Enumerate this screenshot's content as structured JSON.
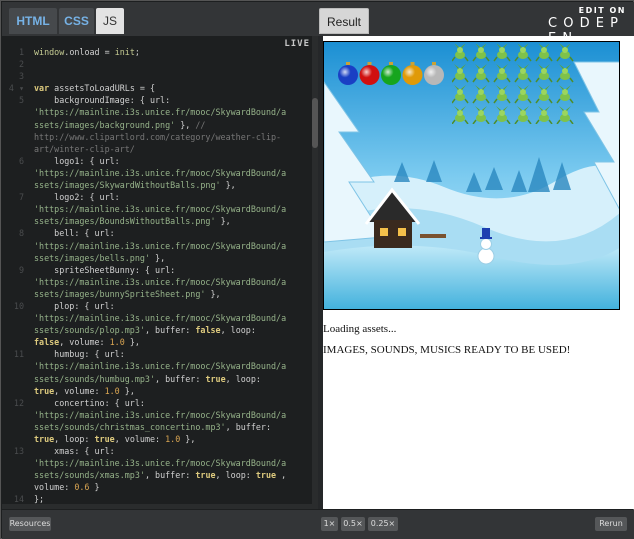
{
  "tabs": {
    "html": "HTML",
    "css": "CSS",
    "js": "JS",
    "result": "Result"
  },
  "brand": {
    "edit_on": "EDIT ON",
    "name": "C O D E P E N"
  },
  "editor": {
    "live_badge": "LIVE",
    "lines": [
      {
        "n": "1",
        "segs": [
          [
            "prop",
            "window"
          ],
          [
            "",
            "."
          ],
          [
            "",
            "onload = "
          ],
          [
            "prop",
            "init"
          ],
          [
            "",
            ";"
          ]
        ]
      },
      {
        "n": "2",
        "segs": []
      },
      {
        "n": "3",
        "segs": []
      },
      {
        "n": "4 ▾",
        "segs": [
          [
            "kw",
            "var"
          ],
          [
            "",
            " assetsToLoadURLs = {"
          ]
        ]
      },
      {
        "n": "5",
        "segs": [
          [
            "",
            "    backgroundImage: { url:"
          ]
        ]
      },
      {
        "n": "",
        "segs": [
          [
            "str",
            "'https://mainline.i3s.unice.fr/mooc/SkywardBound/a"
          ]
        ]
      },
      {
        "n": "",
        "segs": [
          [
            "str",
            "ssets/images/background.png'"
          ],
          [
            "",
            " }, "
          ],
          [
            "cmt",
            "//"
          ]
        ]
      },
      {
        "n": "",
        "segs": [
          [
            "cmt",
            "http://www.clipartlord.com/category/weather-clip-"
          ]
        ]
      },
      {
        "n": "",
        "segs": [
          [
            "cmt",
            "art/winter-clip-art/"
          ]
        ]
      },
      {
        "n": "6",
        "segs": [
          [
            "",
            "    logo1: { url:"
          ]
        ]
      },
      {
        "n": "",
        "segs": [
          [
            "str",
            "'https://mainline.i3s.unice.fr/mooc/SkywardBound/a"
          ]
        ]
      },
      {
        "n": "",
        "segs": [
          [
            "str",
            "ssets/images/SkywardWithoutBalls.png'"
          ],
          [
            "",
            " },"
          ]
        ]
      },
      {
        "n": "7",
        "segs": [
          [
            "",
            "    logo2: { url:"
          ]
        ]
      },
      {
        "n": "",
        "segs": [
          [
            "str",
            "'https://mainline.i3s.unice.fr/mooc/SkywardBound/a"
          ]
        ]
      },
      {
        "n": "",
        "segs": [
          [
            "str",
            "ssets/images/BoundsWithoutBalls.png'"
          ],
          [
            "",
            " },"
          ]
        ]
      },
      {
        "n": "8",
        "segs": [
          [
            "",
            "    bell: { url:"
          ]
        ]
      },
      {
        "n": "",
        "segs": [
          [
            "str",
            "'https://mainline.i3s.unice.fr/mooc/SkywardBound/a"
          ]
        ]
      },
      {
        "n": "",
        "segs": [
          [
            "str",
            "ssets/images/bells.png'"
          ],
          [
            "",
            " },"
          ]
        ]
      },
      {
        "n": "9",
        "segs": [
          [
            "",
            "    spriteSheetBunny: { url:"
          ]
        ]
      },
      {
        "n": "",
        "segs": [
          [
            "str",
            "'https://mainline.i3s.unice.fr/mooc/SkywardBound/a"
          ]
        ]
      },
      {
        "n": "",
        "segs": [
          [
            "str",
            "ssets/images/bunnySpriteSheet.png'"
          ],
          [
            "",
            " },"
          ]
        ]
      },
      {
        "n": "10",
        "segs": [
          [
            "",
            "    plop: { url:"
          ]
        ]
      },
      {
        "n": "",
        "segs": [
          [
            "str",
            "'https://mainline.i3s.unice.fr/mooc/SkywardBound/a"
          ]
        ]
      },
      {
        "n": "",
        "segs": [
          [
            "str",
            "ssets/sounds/plop.mp3'"
          ],
          [
            "",
            ", buffer: "
          ],
          [
            "kw",
            "false"
          ],
          [
            "",
            ", loop:"
          ]
        ]
      },
      {
        "n": "",
        "segs": [
          [
            "kw",
            "false"
          ],
          [
            "",
            ", volume: "
          ],
          [
            "num",
            "1.0"
          ],
          [
            "",
            " },"
          ]
        ]
      },
      {
        "n": "11",
        "segs": [
          [
            "",
            "    humbug: { url:"
          ]
        ]
      },
      {
        "n": "",
        "segs": [
          [
            "str",
            "'https://mainline.i3s.unice.fr/mooc/SkywardBound/a"
          ]
        ]
      },
      {
        "n": "",
        "segs": [
          [
            "str",
            "ssets/sounds/humbug.mp3'"
          ],
          [
            "",
            ", buffer: "
          ],
          [
            "kw",
            "true"
          ],
          [
            "",
            ", loop:"
          ]
        ]
      },
      {
        "n": "",
        "segs": [
          [
            "kw",
            "true"
          ],
          [
            "",
            ", volume: "
          ],
          [
            "num",
            "1.0"
          ],
          [
            "",
            " },"
          ]
        ]
      },
      {
        "n": "12",
        "segs": [
          [
            "",
            "    concertino: { url:"
          ]
        ]
      },
      {
        "n": "",
        "segs": [
          [
            "str",
            "'https://mainline.i3s.unice.fr/mooc/SkywardBound/a"
          ]
        ]
      },
      {
        "n": "",
        "segs": [
          [
            "str",
            "ssets/sounds/christmas_concertino.mp3'"
          ],
          [
            "",
            ", buffer:"
          ]
        ]
      },
      {
        "n": "",
        "segs": [
          [
            "kw",
            "true"
          ],
          [
            "",
            ", loop: "
          ],
          [
            "kw",
            "true"
          ],
          [
            "",
            ", volume: "
          ],
          [
            "num",
            "1.0"
          ],
          [
            "",
            " },"
          ]
        ]
      },
      {
        "n": "13",
        "segs": [
          [
            "",
            "    xmas: { url:"
          ]
        ]
      },
      {
        "n": "",
        "segs": [
          [
            "str",
            "'https://mainline.i3s.unice.fr/mooc/SkywardBound/a"
          ]
        ]
      },
      {
        "n": "",
        "segs": [
          [
            "str",
            "ssets/sounds/xmas.mp3'"
          ],
          [
            "",
            ", buffer: "
          ],
          [
            "kw",
            "true"
          ],
          [
            "",
            ", loop: "
          ],
          [
            "kw",
            "true"
          ],
          [
            "",
            " ,"
          ]
        ]
      },
      {
        "n": "",
        "segs": [
          [
            "",
            "volume: "
          ],
          [
            "num",
            "0.6"
          ],
          [
            "",
            " }"
          ]
        ]
      },
      {
        "n": "14",
        "segs": [
          [
            "",
            "};"
          ]
        ]
      },
      {
        "n": "15",
        "segs": []
      }
    ]
  },
  "result": {
    "status_loading": "Loading assets...",
    "status_ready": "IMAGES, SOUNDS, MUSICS READY TO BE USED!",
    "balls": [
      "#1a3fc4",
      "#d01010",
      "#16a51e",
      "#e09a08",
      "#b8b8b8"
    ]
  },
  "bottombar": {
    "resources": "Resources",
    "zoom_1x": "1×",
    "zoom_05x": "0.5×",
    "zoom_025x": "0.25×",
    "rerun": "Rerun"
  }
}
